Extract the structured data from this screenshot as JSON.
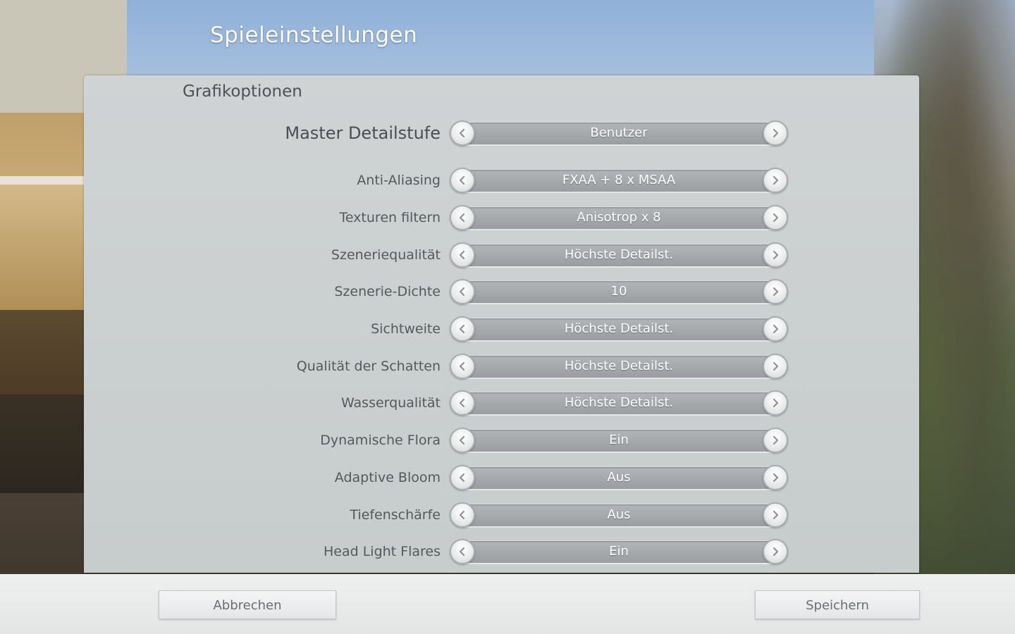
{
  "header": {
    "title": "Spieleinstellungen"
  },
  "panel": {
    "section_title": "Grafikoptionen",
    "settings": [
      {
        "label": "Master Detailstufe",
        "value": "Benutzer"
      },
      {
        "label": "Anti-Aliasing",
        "value": "FXAA + 8 x MSAA"
      },
      {
        "label": "Texturen filtern",
        "value": "Anisotrop x 8"
      },
      {
        "label": "Szeneriequalität",
        "value": "Höchste Detailst."
      },
      {
        "label": "Szenerie-Dichte",
        "value": "10"
      },
      {
        "label": "Sichtweite",
        "value": "Höchste Detailst."
      },
      {
        "label": "Qualität der Schatten",
        "value": "Höchste Detailst."
      },
      {
        "label": "Wasserqualität",
        "value": "Höchste Detailst."
      },
      {
        "label": "Dynamische Flora",
        "value": "Ein"
      },
      {
        "label": "Adaptive Bloom",
        "value": "Aus"
      },
      {
        "label": "Tiefenschärfe",
        "value": "Aus"
      },
      {
        "label": "Head Light Flares",
        "value": "Ein"
      }
    ]
  },
  "footer": {
    "cancel_label": "Abbrechen",
    "save_label": "Speichern"
  },
  "icons": {
    "prev": "chevron-left-icon",
    "next": "chevron-right-icon"
  },
  "colors": {
    "panel": "#cbcfd0",
    "selector_bar": "#a6aaac",
    "label_text": "#55595b",
    "title_text": "#ffffff"
  }
}
